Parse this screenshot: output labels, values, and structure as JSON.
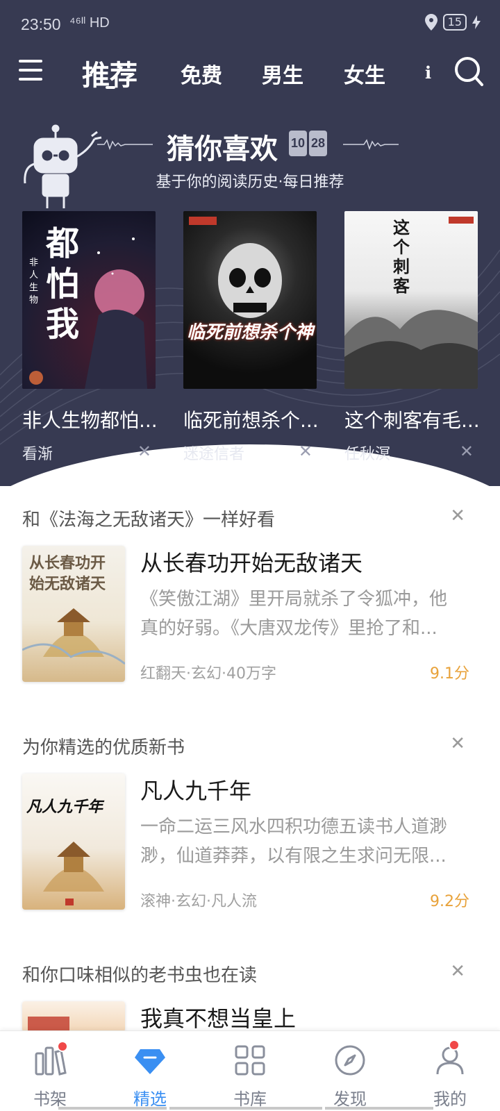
{
  "status_bar": {
    "time": "23:50",
    "network": "⁴⁶ᴵˡ HD",
    "battery": "15"
  },
  "nav": {
    "tabs": [
      "推荐",
      "免费",
      "男生",
      "女生",
      "i"
    ],
    "active_tab": "推荐"
  },
  "guess": {
    "title": "猜你喜欢",
    "date_month": "10",
    "date_day": "28",
    "subtitle": "基于你的阅读历史·每日推荐",
    "books": [
      {
        "title": "非人生物都怕...",
        "author": "看渐",
        "cover_text": "都怕我",
        "cover_side": "非人生物"
      },
      {
        "title": "临死前想杀个...",
        "author": "迷途信者",
        "cover_text": "临死前想杀个神"
      },
      {
        "title": "这个刺客有毛...",
        "author": "任秋溟",
        "cover_text": "这个刺客"
      }
    ]
  },
  "sections": [
    {
      "header": "和《法海之无敌诸天》一样好看",
      "book": {
        "title": "从长春功开始无敌诸天",
        "cover_text": "从长春功开始无敌诸天",
        "desc_line1": "《笑傲江湖》里开局就杀了令狐冲，他",
        "desc_line2": "真的好弱。《大唐双龙传》里抢了和...",
        "meta": "红翻天·玄幻·40万字",
        "score": "9.1分"
      }
    },
    {
      "header": "为你精选的优质新书",
      "book": {
        "title": "凡人九千年",
        "cover_text": "凡人九千年",
        "desc_line1": "一命二运三风水四积功德五读书人道渺",
        "desc_line2": "渺，仙道莽莽，以有限之生求问无限...",
        "meta": "滚神·玄幻·凡人流",
        "score": "9.2分"
      }
    },
    {
      "header": "和你口味相似的老书虫也在读",
      "book": {
        "title": "我真不想当皇上"
      }
    }
  ],
  "tab_bar": [
    {
      "label": "书架",
      "icon": "bookshelf-icon",
      "badge": true
    },
    {
      "label": "精选",
      "icon": "diamond-icon",
      "active": true
    },
    {
      "label": "书库",
      "icon": "grid-icon"
    },
    {
      "label": "发现",
      "icon": "compass-icon"
    },
    {
      "label": "我的",
      "icon": "user-icon",
      "badge": true
    }
  ],
  "colors": {
    "hero_bg": "#373a52",
    "accent": "#3a8ff2",
    "score": "#e8a23a",
    "badge": "#f04848"
  }
}
